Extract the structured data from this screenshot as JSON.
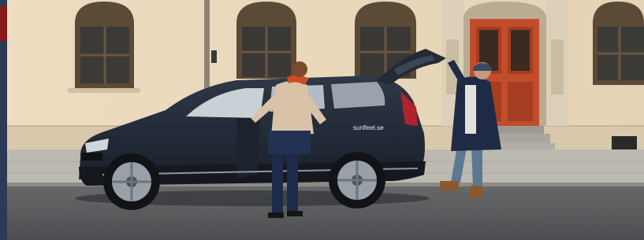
{
  "photo": {
    "car_decal": "sunfleet.se"
  },
  "colors": {
    "facade": "#e9d8bd",
    "sidewalk": "#b9b6ad",
    "street": "#5c5d60",
    "car_body": "#252d3a",
    "door": "#c24d2b",
    "left_strip": "#2c3a56",
    "red_accent": "#8a1a1a"
  }
}
